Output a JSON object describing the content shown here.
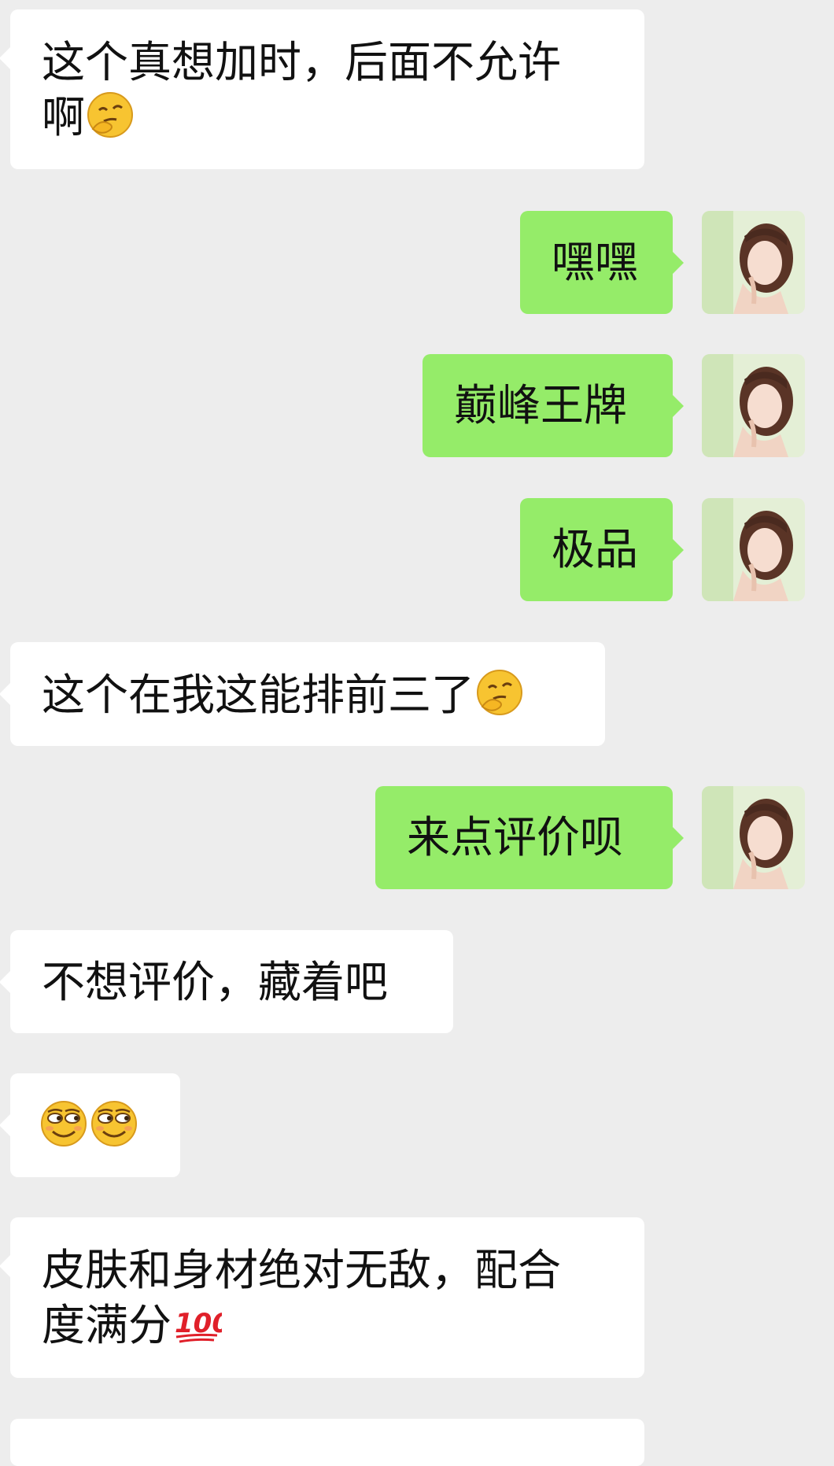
{
  "messages": [
    {
      "side": "received",
      "lines": [
        "这个真想加时，后面不允许",
        "啊"
      ],
      "emoji": "thinking-face-emoji"
    },
    {
      "side": "sent",
      "text": "嘿嘿"
    },
    {
      "side": "sent",
      "text": "巅峰王牌"
    },
    {
      "side": "sent",
      "text": "极品"
    },
    {
      "side": "received",
      "text": "这个在我这能排前三了",
      "emoji": "thinking-face-emoji"
    },
    {
      "side": "sent",
      "text": "来点评价呗"
    },
    {
      "side": "received",
      "text": "不想评价，藏着吧"
    },
    {
      "side": "received",
      "emojis": [
        "smirking-face-emoji",
        "smirking-face-emoji"
      ]
    },
    {
      "side": "received",
      "lines": [
        "皮肤和身材绝对无敌，配合",
        "度满分"
      ],
      "emoji": "hundred-points-emoji"
    }
  ],
  "colors": {
    "background": "#ededed",
    "received_bubble": "#ffffff",
    "sent_bubble": "#95ec69",
    "text": "#111111"
  }
}
